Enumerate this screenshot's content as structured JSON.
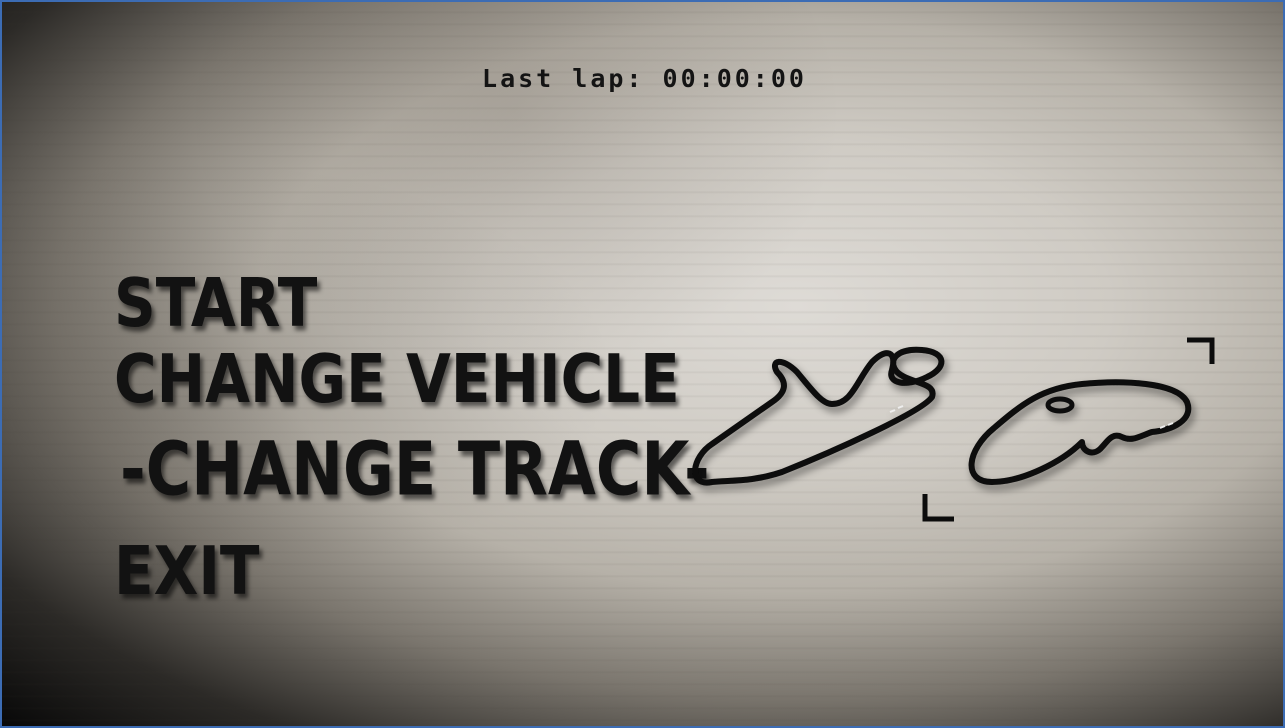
{
  "hud": {
    "last_lap_label": "Last lap:",
    "last_lap_time": "00:00:00"
  },
  "menu": {
    "items": [
      {
        "label": "START"
      },
      {
        "label": "CHANGE VEHICLE"
      },
      {
        "label": "-CHANGE TRACK-"
      },
      {
        "label": "EXIT"
      }
    ],
    "selected_index": 2
  },
  "track_selector": {
    "tracks": [
      {
        "icon": "track-1-outline-icon"
      },
      {
        "icon": "track-2-outline-icon"
      }
    ],
    "selected_index": 1,
    "selection_icon": "selection-bracket-icon"
  },
  "colors": {
    "text": "#121212",
    "frame_border": "#3c6cb4",
    "background_center": "#dedbd6",
    "vignette": "#080808"
  }
}
